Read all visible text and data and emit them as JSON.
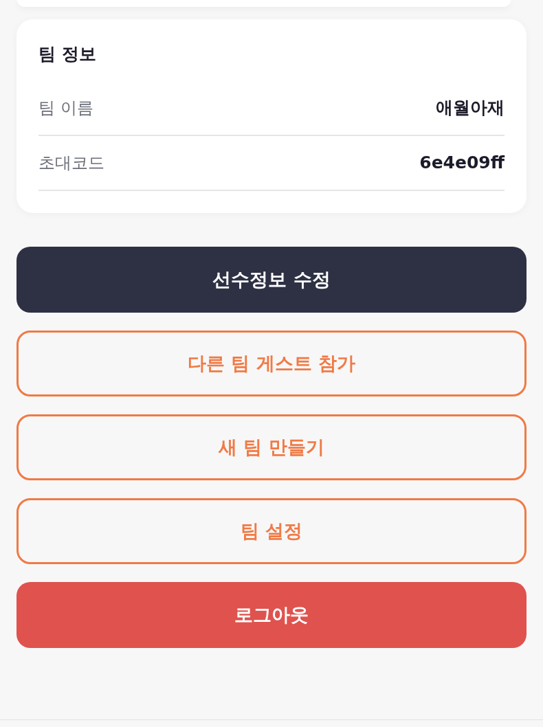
{
  "team_info": {
    "title": "팀 정보",
    "rows": [
      {
        "label": "팀 이름",
        "value": "애월아재"
      },
      {
        "label": "초대코드",
        "value": "6e4e09ff"
      }
    ]
  },
  "buttons": [
    {
      "label": "선수정보 수정",
      "kind": "primary"
    },
    {
      "label": "다른 팀 게스트 참가",
      "kind": "outline"
    },
    {
      "label": "새 팀 만들기",
      "kind": "outline"
    },
    {
      "label": "팀 설정",
      "kind": "outline"
    },
    {
      "label": "로그아웃",
      "kind": "danger"
    }
  ]
}
